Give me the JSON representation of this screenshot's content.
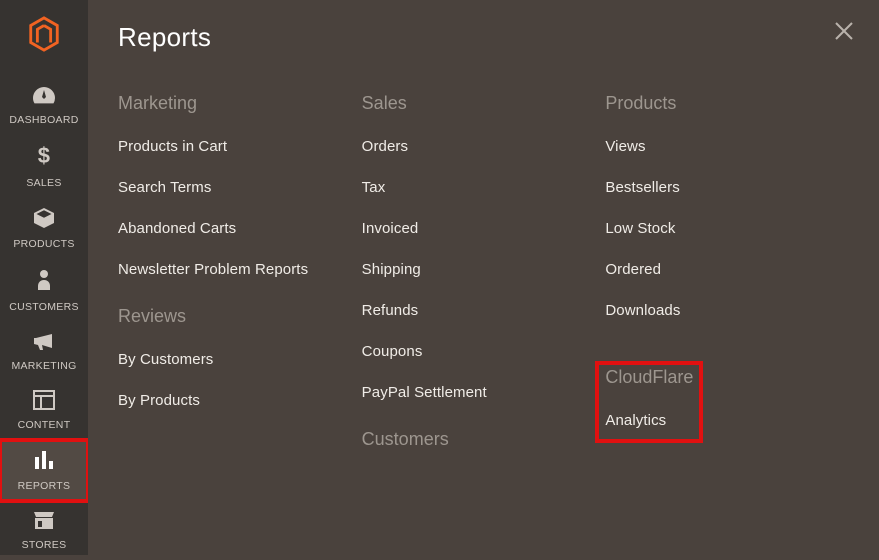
{
  "nav": {
    "items": [
      {
        "id": "dashboard",
        "label": "DASHBOARD"
      },
      {
        "id": "sales",
        "label": "SALES"
      },
      {
        "id": "products",
        "label": "PRODUCTS"
      },
      {
        "id": "customers",
        "label": "CUSTOMERS"
      },
      {
        "id": "marketing",
        "label": "MARKETING"
      },
      {
        "id": "content",
        "label": "CONTENT"
      },
      {
        "id": "reports",
        "label": "REPORTS"
      },
      {
        "id": "stores",
        "label": "STORES"
      }
    ],
    "active": "reports"
  },
  "panel": {
    "title": "Reports"
  },
  "sections": {
    "marketing": {
      "heading": "Marketing",
      "items": [
        "Products in Cart",
        "Search Terms",
        "Abandoned Carts",
        "Newsletter Problem Reports"
      ]
    },
    "reviews": {
      "heading": "Reviews",
      "items": [
        "By Customers",
        "By Products"
      ]
    },
    "sales": {
      "heading": "Sales",
      "items": [
        "Orders",
        "Tax",
        "Invoiced",
        "Shipping",
        "Refunds",
        "Coupons",
        "PayPal Settlement"
      ]
    },
    "customers": {
      "heading": "Customers"
    },
    "products": {
      "heading": "Products",
      "items": [
        "Views",
        "Bestsellers",
        "Low Stock",
        "Ordered",
        "Downloads"
      ]
    },
    "cloudflare": {
      "heading": "CloudFlare",
      "items": [
        "Analytics"
      ]
    }
  }
}
